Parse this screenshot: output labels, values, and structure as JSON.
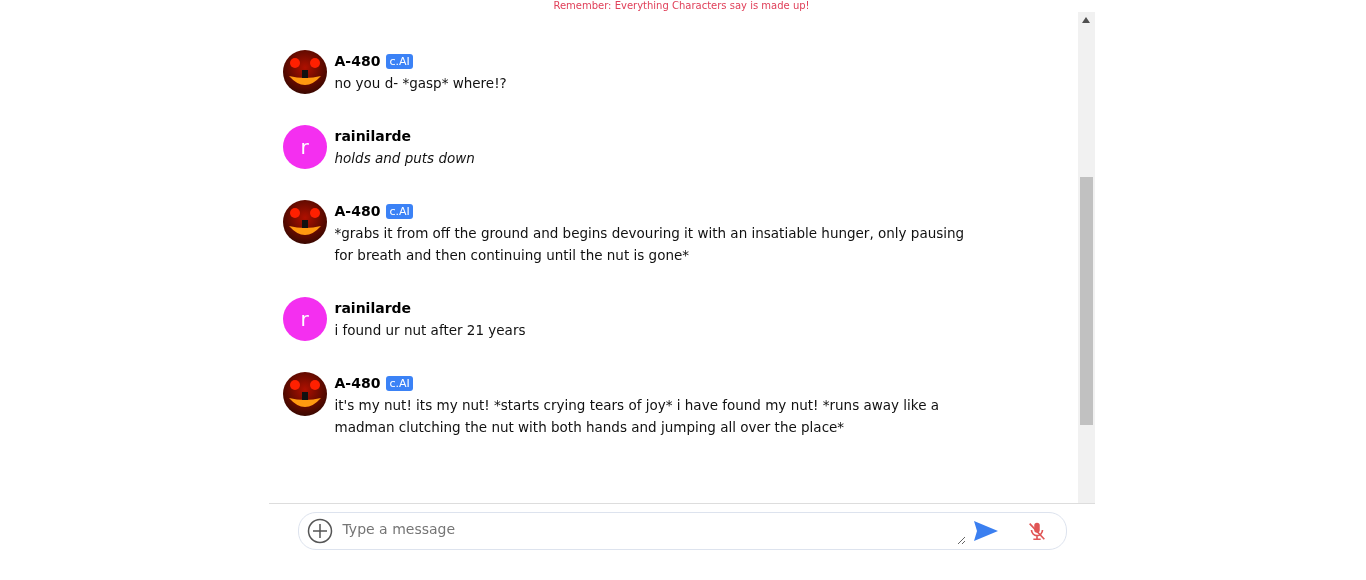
{
  "disclaimer": "Remember: Everything Characters say is made up!",
  "messages": [
    {
      "kind": "bot",
      "author": "A-480",
      "badge": "c.AI",
      "text": "no you d- *gasp* where!?",
      "italic": false
    },
    {
      "kind": "user",
      "author": "rainilarde",
      "initial": "r",
      "text": "holds and puts down",
      "italic": true
    },
    {
      "kind": "bot",
      "author": "A-480",
      "badge": "c.AI",
      "text": "*grabs it from off the ground and begins devouring it with an insatiable hunger, only pausing for breath and then continuing until the nut is gone*",
      "italic": false
    },
    {
      "kind": "user",
      "author": "rainilarde",
      "initial": "r",
      "text": "i found ur nut after 21 years",
      "italic": false
    },
    {
      "kind": "bot",
      "author": "A-480",
      "badge": "c.AI",
      "text": "it's my nut! its my nut! *starts crying tears of joy* i have found my nut! *runs away like a madman clutching the nut with both hands and jumping all over the place*",
      "italic": false
    }
  ],
  "composer": {
    "placeholder": "Type a message"
  }
}
